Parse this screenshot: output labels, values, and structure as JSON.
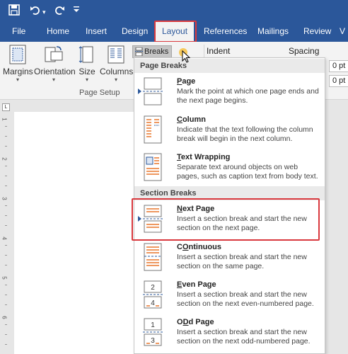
{
  "qat": {
    "save_icon": "save-icon",
    "undo_icon": "undo-icon",
    "redo_icon": "redo-icon",
    "customize_icon": "customize-qat-icon"
  },
  "tabs": [
    "File",
    "Home",
    "Insert",
    "Design",
    "Layout",
    "References",
    "Mailings",
    "Review",
    "V"
  ],
  "active_tab": "Layout",
  "ribbon": {
    "margins": "Margins",
    "orientation": "Orientation",
    "size": "Size",
    "columns": "Columns",
    "breaks": "Breaks",
    "group_label": "Page Setup",
    "indent": "Indent",
    "spacing": "Spacing",
    "spacing_before": "0 pt",
    "spacing_after": "0 pt"
  },
  "ruler_numbers": [
    "1",
    "2",
    "3",
    "4",
    "5",
    "6"
  ],
  "menu": {
    "page_breaks_header": "Page Breaks",
    "section_breaks_header": "Section Breaks",
    "page": {
      "title": "Page",
      "underline": "P",
      "rest": "age",
      "desc": "Mark the point at which one page ends and the next page begins."
    },
    "column": {
      "title": "Column",
      "underline": "C",
      "rest": "olumn",
      "desc": "Indicate that the text following the column break will begin in the next column."
    },
    "text_wrapping": {
      "title": "Text Wrapping",
      "underline": "T",
      "rest": "ext Wrapping",
      "desc": "Separate text around objects on web pages, such as caption text from body text."
    },
    "next_page": {
      "title": "Next Page",
      "underline": "N",
      "rest": "ext Page",
      "desc": "Insert a section break and start the new section on the next page."
    },
    "continuous": {
      "title": "Continuous",
      "underline": "O",
      "rest": "ntinuous",
      "prefix": "C",
      "desc": "Insert a section break and start the new section on the same page."
    },
    "even_page": {
      "title": "Even Page",
      "underline": "E",
      "rest": "ven Page",
      "desc": "Insert a section break and start the new section on the next even-numbered page."
    },
    "odd_page": {
      "title": "Odd Page",
      "underline": "D",
      "prefix": "O",
      "rest": "d Page",
      "desc": "Insert a section break and start the new section on the next odd-numbered page."
    }
  },
  "icon_numbers": {
    "even_top": "2",
    "even_bottom": "4",
    "odd_top": "1",
    "odd_bottom": "3"
  },
  "colors": {
    "accent": "#2b579a",
    "highlight": "#d9393e",
    "orange": "#e8762b"
  }
}
